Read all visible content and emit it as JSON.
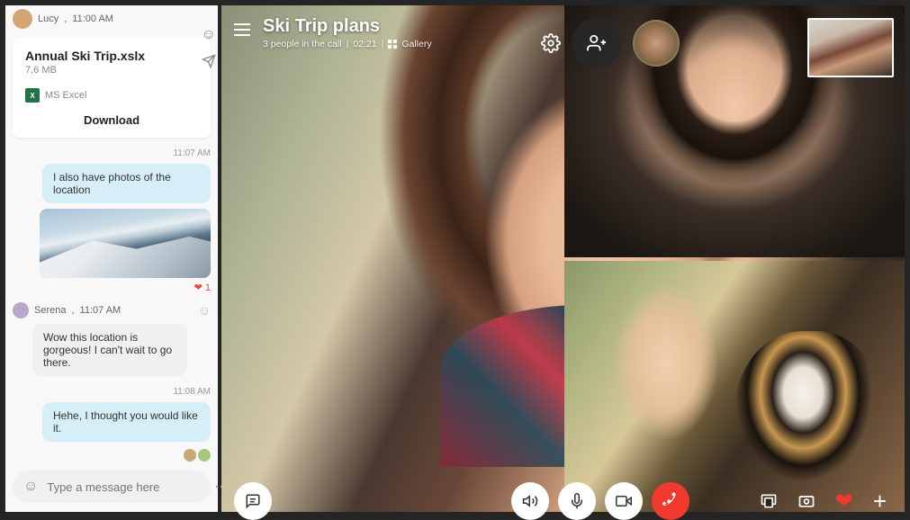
{
  "chat": {
    "sender1": {
      "name": "Lucy",
      "time": "11:00 AM"
    },
    "file": {
      "name": "Annual Ski Trip.xslx",
      "size": "7,6 MB",
      "type_label": "MS Excel",
      "download": "Download"
    },
    "t1": "11:07 AM",
    "msg_photos": "I also have photos of the location",
    "reaction_count": "1",
    "sender2": {
      "name": "Serena",
      "time": "11:07 AM"
    },
    "msg_wow": "Wow this location is gorgeous! I can't wait to go there.",
    "t2": "11:08 AM",
    "msg_hehe": "Hehe, I thought you would like it.",
    "composer_placeholder": "Type a message here"
  },
  "call": {
    "title": "Ski Trip plans",
    "people": "3 people in the call",
    "duration": "02:21",
    "view_mode": "Gallery"
  }
}
